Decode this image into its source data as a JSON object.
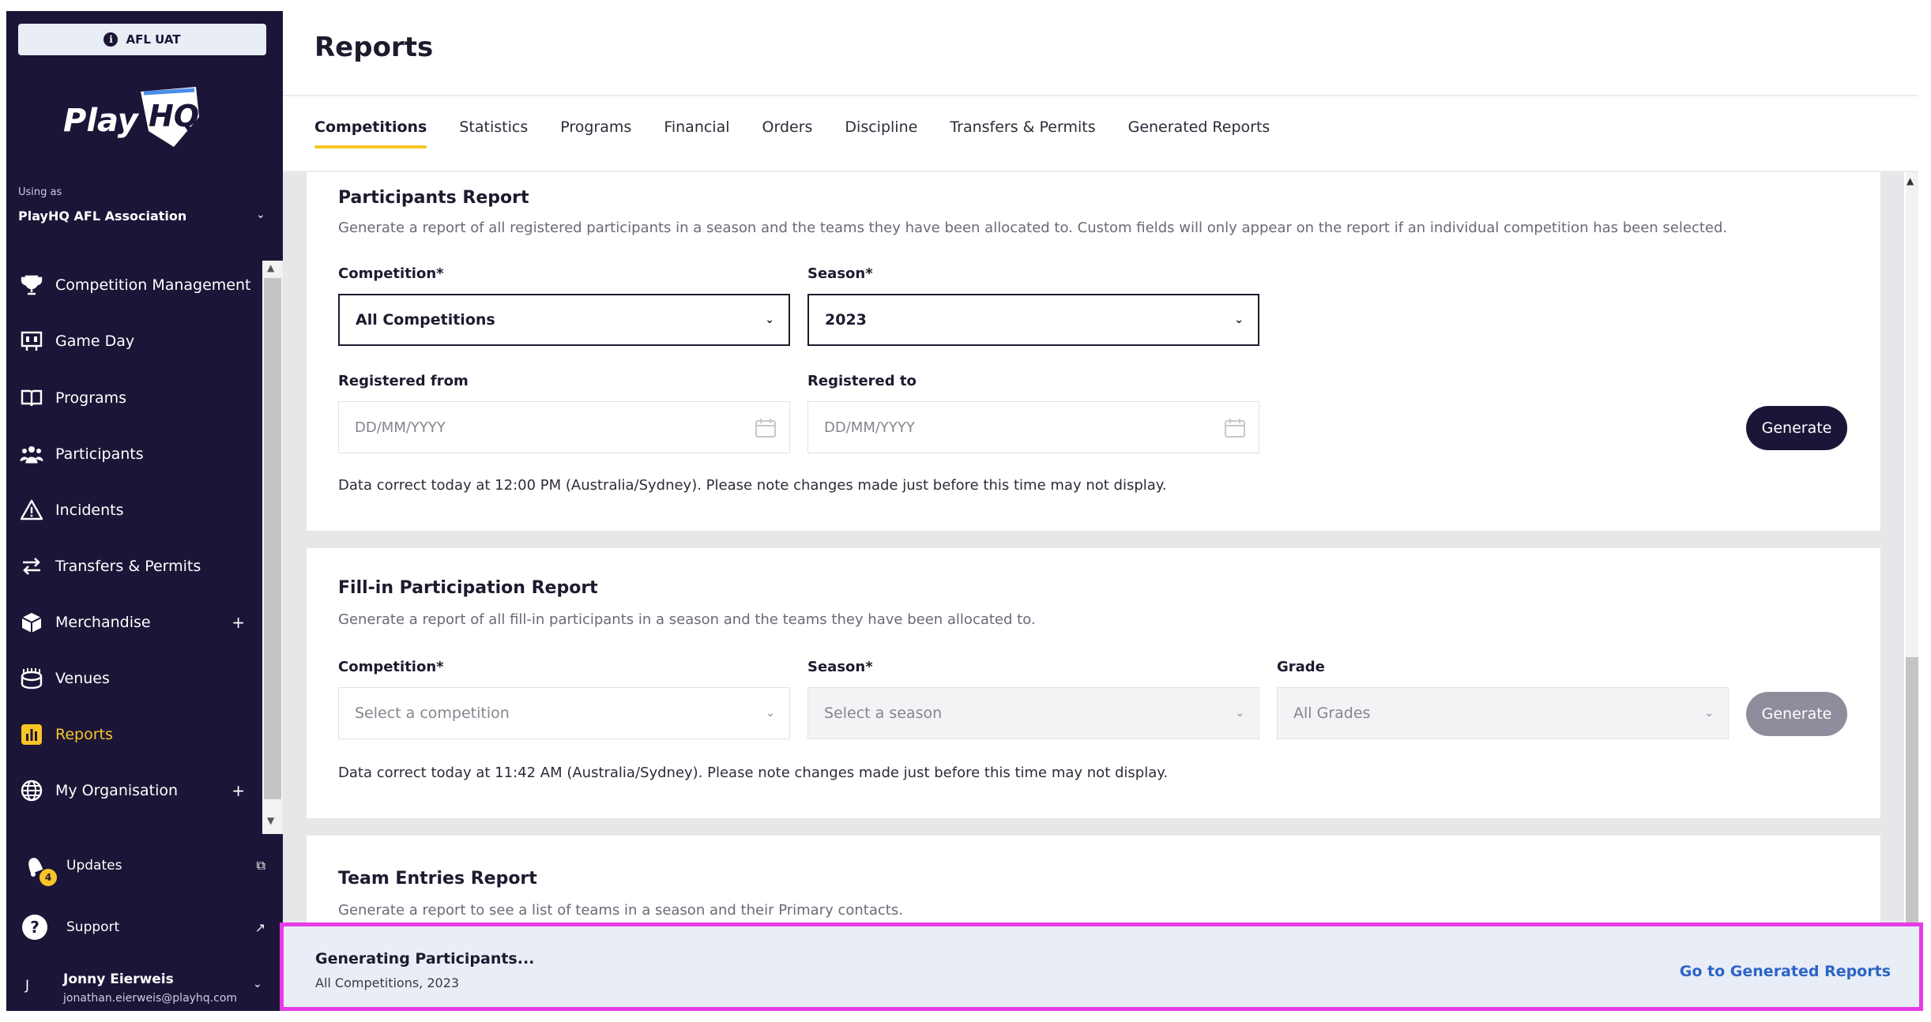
{
  "env_badge": "AFL UAT",
  "logo_text": "PlayHQ",
  "sidebar": {
    "using_as_label": "Using as",
    "org_name": "PlayHQ AFL Association",
    "items": [
      {
        "label": "Competition Management",
        "icon": "trophy-icon"
      },
      {
        "label": "Game Day",
        "icon": "scoreboard-icon"
      },
      {
        "label": "Programs",
        "icon": "book-icon"
      },
      {
        "label": "Participants",
        "icon": "people-icon"
      },
      {
        "label": "Incidents",
        "icon": "warning-icon"
      },
      {
        "label": "Transfers & Permits",
        "icon": "transfer-arrows-icon"
      },
      {
        "label": "Merchandise",
        "icon": "box-icon"
      },
      {
        "label": "Venues",
        "icon": "stadium-icon"
      },
      {
        "label": "Reports",
        "icon": "bar-chart-icon",
        "active": true
      },
      {
        "label": "My Organisation",
        "icon": "globe-icon"
      }
    ],
    "updates_label": "Updates",
    "updates_count": "4",
    "support_label": "Support",
    "user": {
      "initial": "J",
      "name": "Jonny Eierweis",
      "email": "jonathan.eierweis@playhq.com"
    }
  },
  "page_title": "Reports",
  "tabs": [
    "Competitions",
    "Statistics",
    "Programs",
    "Financial",
    "Orders",
    "Discipline",
    "Transfers & Permits",
    "Generated Reports"
  ],
  "participants_report": {
    "title": "Participants Report",
    "description": "Generate a report of all registered participants in a season and the teams they have been allocated to. Custom fields will only appear on the report if an individual competition has been selected.",
    "competition_label": "Competition*",
    "competition_value": "All Competitions",
    "season_label": "Season*",
    "season_value": "2023",
    "registered_from_label": "Registered from",
    "registered_to_label": "Registered to",
    "date_placeholder": "DD/MM/YYYY",
    "generate_label": "Generate",
    "note": "Data correct today at 12:00 PM (Australia/Sydney). Please note changes made just before this time may not display."
  },
  "fillin_report": {
    "title": "Fill-in Participation Report",
    "description": "Generate a report of all fill-in participants in a season and the teams they have been allocated to.",
    "competition_label": "Competition*",
    "competition_placeholder": "Select a competition",
    "season_label": "Season*",
    "season_placeholder": "Select a season",
    "grade_label": "Grade",
    "grade_value": "All Grades",
    "generate_label": "Generate",
    "note": "Data correct today at 11:42 AM (Australia/Sydney). Please note changes made just before this time may not display."
  },
  "team_entries_report": {
    "title": "Team Entries Report",
    "description": "Generate a report to see a list of teams in a season and their Primary contacts."
  },
  "toast": {
    "title": "Generating Participants...",
    "subtitle": "All Competitions, 2023",
    "link": "Go to Generated Reports"
  },
  "colors": {
    "sidebar_bg": "#1c1537",
    "accent": "#f7c526",
    "link": "#2b64c5",
    "highlight": "#e53ce6"
  }
}
